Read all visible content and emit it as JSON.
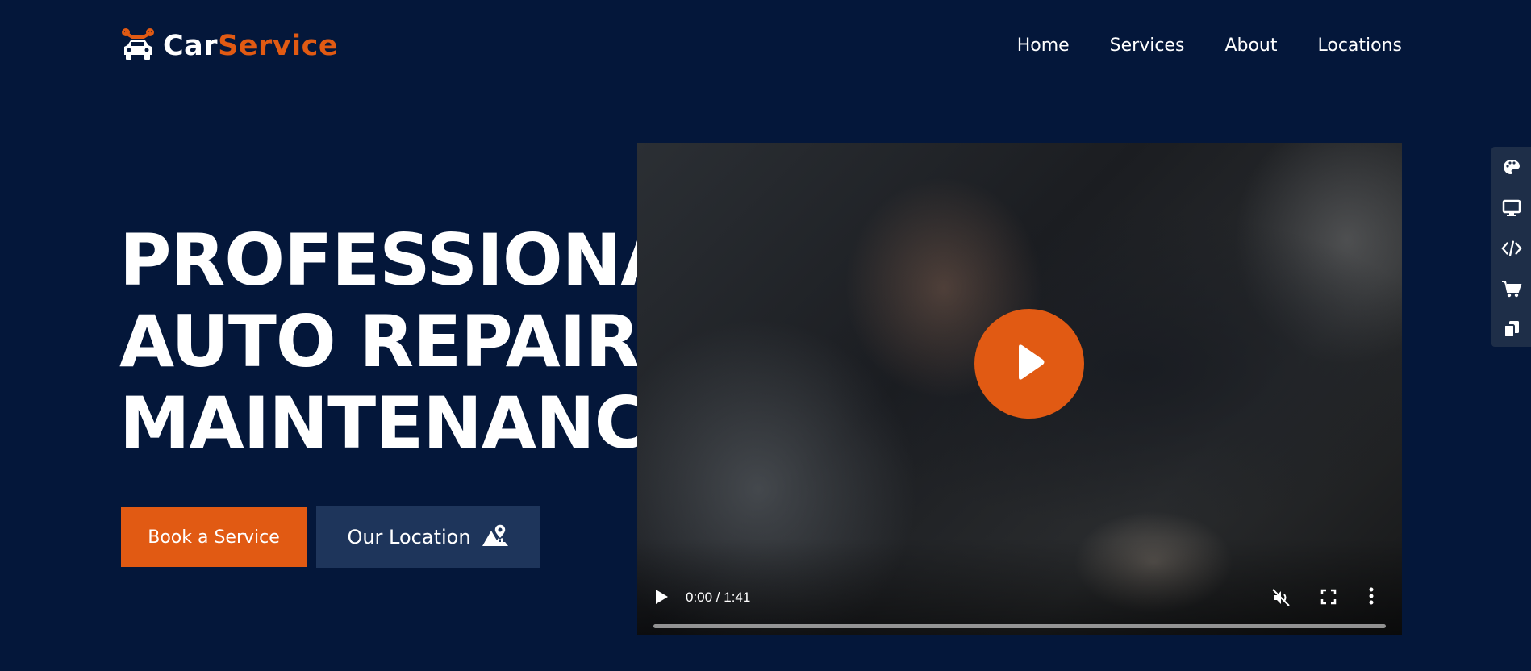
{
  "brand": {
    "name_part1": "Car",
    "name_part2": "Service",
    "logo_icon": "car-wrench-icon",
    "accent_color": "#e15a13"
  },
  "nav": {
    "items": [
      "Home",
      "Services",
      "About",
      "Locations"
    ]
  },
  "hero": {
    "title": "PROFESSIONAL\nAUTO REPAIR &\nMAINTENANCE",
    "primary_button": "Book a Service",
    "secondary_button": "Our Location",
    "secondary_button_icon": "map-location-icon"
  },
  "video": {
    "play_overlay_icon": "play-icon",
    "time": "0:00 / 1:41",
    "progress": 0,
    "controls": [
      "play-icon",
      "mute-icon",
      "fullscreen-icon",
      "more-vertical-icon"
    ]
  },
  "tool_panel": {
    "icons": [
      "palette-icon",
      "monitor-icon",
      "code-icon",
      "cart-icon",
      "copy-icon"
    ]
  },
  "colors": {
    "background": "#04173a",
    "primary_button": "#e15a13",
    "secondary_button": "#1e355b",
    "tool_panel": "#1e2e48"
  }
}
